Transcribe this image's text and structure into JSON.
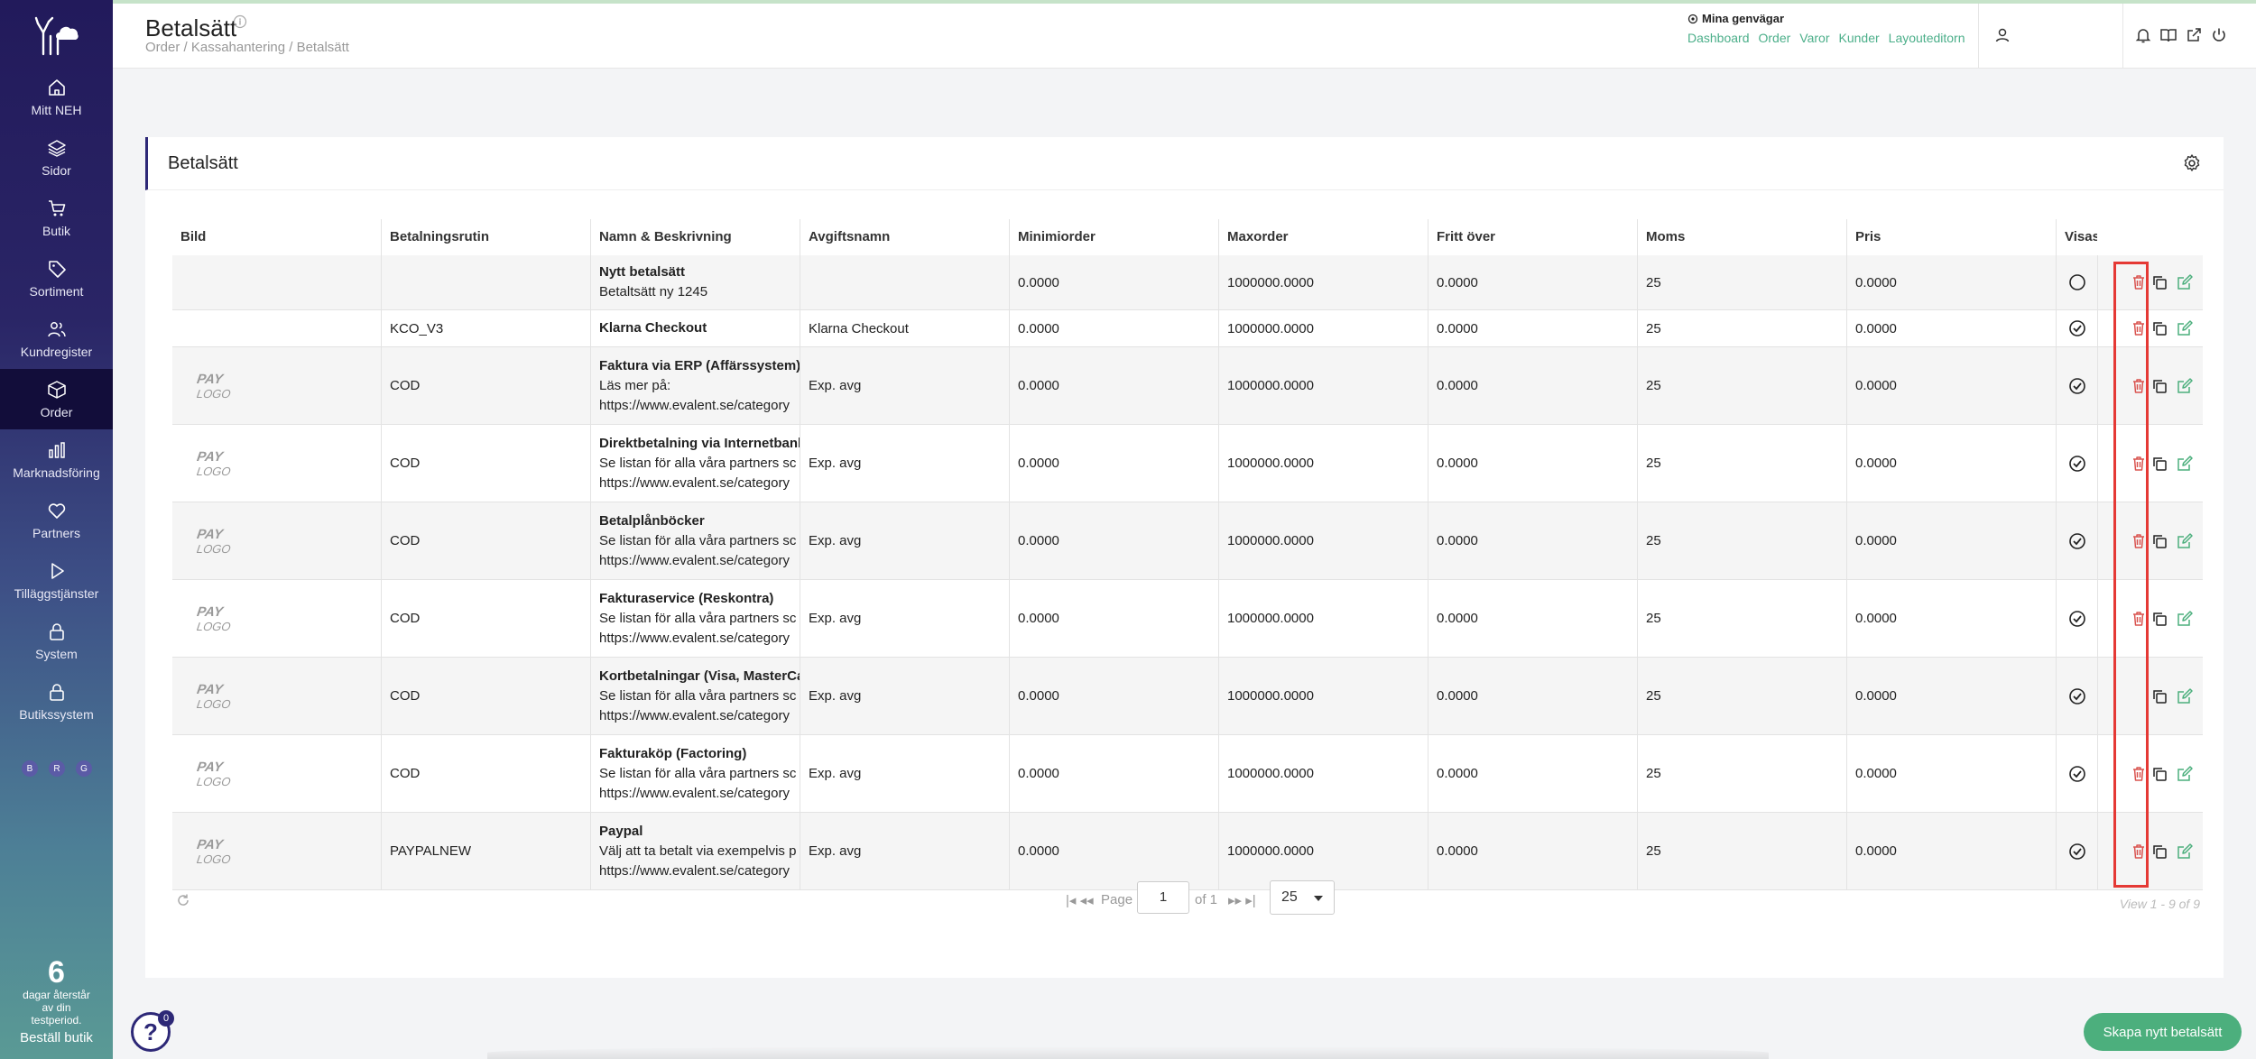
{
  "sidebar": {
    "items": [
      {
        "label": "Mitt NEH",
        "icon": "home-icon"
      },
      {
        "label": "Sidor",
        "icon": "layers-icon"
      },
      {
        "label": "Butik",
        "icon": "cart-icon"
      },
      {
        "label": "Sortiment",
        "icon": "tag-icon"
      },
      {
        "label": "Kundregister",
        "icon": "users-icon"
      },
      {
        "label": "Order",
        "icon": "box-icon"
      },
      {
        "label": "Marknadsföring",
        "icon": "bar-chart-icon"
      },
      {
        "label": "Partners",
        "icon": "heart-icon"
      },
      {
        "label": "Tilläggstjänster",
        "icon": "play-icon"
      },
      {
        "label": "System",
        "icon": "lock-icon"
      },
      {
        "label": "Butikssystem",
        "icon": "lock-icon"
      }
    ],
    "dots": [
      "B",
      "R",
      "G"
    ],
    "trial": {
      "days": "6",
      "text_1": "dagar återstår",
      "text_2": "av din",
      "text_3": "testperiod.",
      "cta": "Beställ butik"
    }
  },
  "header": {
    "title": "Betalsätt",
    "breadcrumb": "Order / Kassahantering / Betalsätt",
    "shortcuts_label": "Mina genvägar",
    "shortcuts": [
      "Dashboard",
      "Order",
      "Varor",
      "Kunder",
      "Layouteditorn"
    ]
  },
  "card": {
    "title": "Betalsätt"
  },
  "table": {
    "columns": [
      "Bild",
      "Betalningsrutin",
      "Namn & Beskrivning",
      "Avgiftsnamn",
      "Minimiorder",
      "Maxorder",
      "Fritt över",
      "Moms",
      "Pris",
      "Visas"
    ],
    "rows": [
      {
        "logo": false,
        "rutin": "",
        "name": "Nytt betalsätt",
        "desc1": "Betaltsätt ny 1245",
        "desc2": "",
        "fee": "",
        "min": "0.0000",
        "max": "1000000.0000",
        "free": "0.0000",
        "moms": "25",
        "price": "0.0000",
        "visible": false,
        "delete": true
      },
      {
        "logo": false,
        "rutin": "KCO_V3",
        "name": "Klarna Checkout",
        "desc1": "",
        "desc2": "",
        "fee": "Klarna Checkout",
        "min": "0.0000",
        "max": "1000000.0000",
        "free": "0.0000",
        "moms": "25",
        "price": "0.0000",
        "visible": true,
        "delete": true
      },
      {
        "logo": true,
        "rutin": "COD",
        "name": "Faktura via ERP (Affärssystem)",
        "desc1": "Läs mer på:",
        "desc2": "https://www.evalent.se/category",
        "fee": "Exp. avg",
        "min": "0.0000",
        "max": "1000000.0000",
        "free": "0.0000",
        "moms": "25",
        "price": "0.0000",
        "visible": true,
        "delete": true
      },
      {
        "logo": true,
        "rutin": "COD",
        "name": "Direktbetalning via Internetbank",
        "desc1": "Se listan för alla våra partners sc",
        "desc2": "https://www.evalent.se/category",
        "fee": "Exp. avg",
        "min": "0.0000",
        "max": "1000000.0000",
        "free": "0.0000",
        "moms": "25",
        "price": "0.0000",
        "visible": true,
        "delete": true
      },
      {
        "logo": true,
        "rutin": "COD",
        "name": "Betalplånböcker",
        "desc1": "Se listan för alla våra partners sc",
        "desc2": "https://www.evalent.se/category",
        "fee": "Exp. avg",
        "min": "0.0000",
        "max": "1000000.0000",
        "free": "0.0000",
        "moms": "25",
        "price": "0.0000",
        "visible": true,
        "delete": true
      },
      {
        "logo": true,
        "rutin": "COD",
        "name": "Fakturaservice (Reskontra)",
        "desc1": "Se listan för alla våra partners sc",
        "desc2": "https://www.evalent.se/category",
        "fee": "Exp. avg",
        "min": "0.0000",
        "max": "1000000.0000",
        "free": "0.0000",
        "moms": "25",
        "price": "0.0000",
        "visible": true,
        "delete": true
      },
      {
        "logo": true,
        "rutin": "COD",
        "name": "Kortbetalningar (Visa, MasterCa",
        "desc1": "Se listan för alla våra partners sc",
        "desc2": "https://www.evalent.se/category",
        "fee": "Exp. avg",
        "min": "0.0000",
        "max": "1000000.0000",
        "free": "0.0000",
        "moms": "25",
        "price": "0.0000",
        "visible": true,
        "delete": false
      },
      {
        "logo": true,
        "rutin": "COD",
        "name": "Fakturaköp (Factoring)",
        "desc1": "Se listan för alla våra partners sc",
        "desc2": "https://www.evalent.se/category",
        "fee": "Exp. avg",
        "min": "0.0000",
        "max": "1000000.0000",
        "free": "0.0000",
        "moms": "25",
        "price": "0.0000",
        "visible": true,
        "delete": true
      },
      {
        "logo": true,
        "rutin": "PAYPALNEW",
        "name": "Paypal",
        "desc1": "Välj att ta betalt via exempelvis p",
        "desc2": "https://www.evalent.se/category",
        "fee": "Exp. avg",
        "min": "0.0000",
        "max": "1000000.0000",
        "free": "0.0000",
        "moms": "25",
        "price": "0.0000",
        "visible": true,
        "delete": true
      }
    ]
  },
  "pager": {
    "first": "|◂ ◂◂",
    "page_label": "Page",
    "page_value": "1",
    "of_label": "of 1",
    "last": "▸▸ ▸|",
    "page_size": "25",
    "view_text": "View 1 - 9 of 9"
  },
  "help": {
    "badge": "0",
    "glyph": "?"
  },
  "create_button": "Skapa nytt betalsätt",
  "colors": {
    "accent": "#2d2877",
    "green": "#4caf7d",
    "delete_red": "#d9534f",
    "highlight": "#e53935"
  }
}
